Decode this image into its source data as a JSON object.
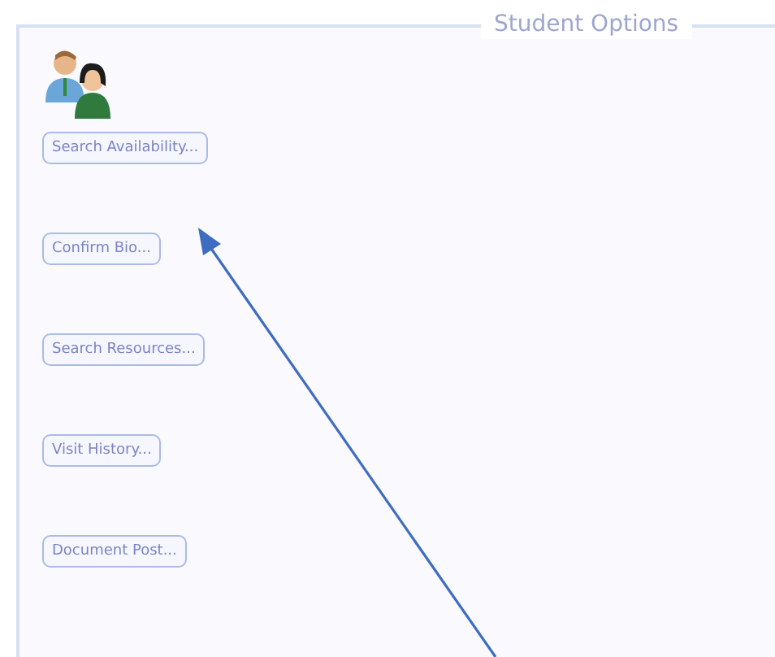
{
  "panel": {
    "title": "Student Options"
  },
  "buttons": [
    {
      "label": "Search Availability..."
    },
    {
      "label": "Confirm Bio..."
    },
    {
      "label": "Search Resources..."
    },
    {
      "label": "Visit History..."
    },
    {
      "label": "Document Post..."
    }
  ]
}
